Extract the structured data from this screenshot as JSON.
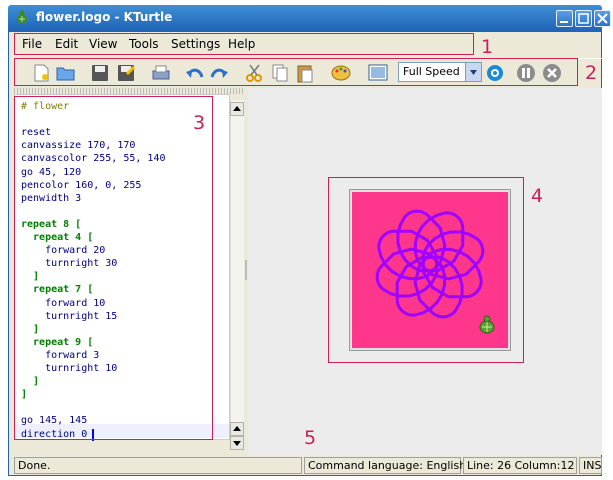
{
  "window": {
    "title": "flower.logo - KTurtle"
  },
  "menubar": {
    "items": [
      "File",
      "Edit",
      "View",
      "Tools",
      "Settings",
      "Help"
    ]
  },
  "toolbar": {
    "speed_value": "Full Speed",
    "icons": [
      "new-icon",
      "open-icon",
      "save-icon",
      "save-as-icon",
      "print-icon",
      "undo-icon",
      "redo-icon",
      "cut-icon",
      "copy-icon",
      "paste-icon",
      "color-picker-icon",
      "fullscreen-icon",
      "run-icon",
      "pause-icon",
      "stop-icon"
    ]
  },
  "editor": {
    "lines": [
      "# flower",
      "",
      "reset",
      "canvassize 170, 170",
      "canvascolor 255, 55, 140",
      "go 45, 120",
      "pencolor 160, 0, 255",
      "penwidth 3",
      "",
      "repeat 8 [",
      "  repeat 4 [",
      "    forward 20",
      "    turnright 30",
      "  ]",
      "  repeat 7 [",
      "    forward 10",
      "    turnright 15",
      "  ]",
      "  repeat 9 [",
      "    forward 3",
      "    turnright 10",
      "  ]",
      "]",
      "",
      "go 145, 145",
      "direction 0"
    ]
  },
  "canvas": {
    "background": "#ff378c",
    "pen_color": "#a000ff"
  },
  "statusbar": {
    "status": "Done.",
    "language": "Command language: English",
    "position": "Line: 26 Column:12",
    "mode": "INS"
  },
  "annotations": {
    "labels": [
      "1",
      "2",
      "3",
      "4",
      "5"
    ]
  }
}
